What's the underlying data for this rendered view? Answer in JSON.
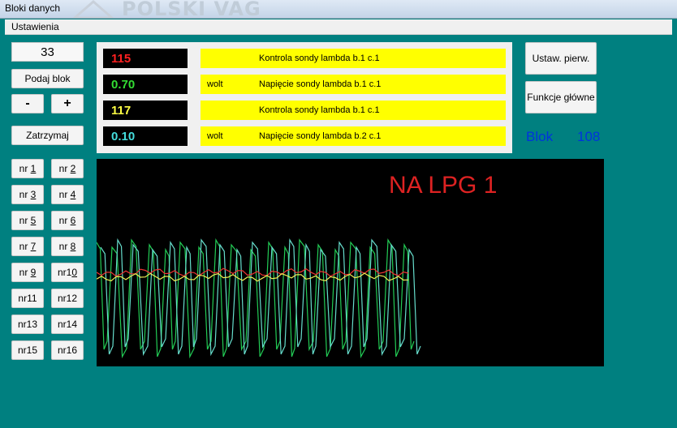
{
  "window": {
    "title": "Bloki danych",
    "watermark": "POLSKI VAG"
  },
  "menu": {
    "items": [
      "Ustawienia"
    ]
  },
  "controls": {
    "counter_value": "33",
    "submit_label": "Podaj blok",
    "minus_label": "-",
    "plus_label": "+",
    "stop_label": "Zatrzymaj"
  },
  "nr_buttons": [
    {
      "prefix": "nr ",
      "digit": "1"
    },
    {
      "prefix": "nr ",
      "digit": "2"
    },
    {
      "prefix": "nr ",
      "digit": "3"
    },
    {
      "prefix": "nr ",
      "digit": "4"
    },
    {
      "prefix": "nr ",
      "digit": "5"
    },
    {
      "prefix": "nr ",
      "digit": "6"
    },
    {
      "prefix": "nr ",
      "digit": "7"
    },
    {
      "prefix": "nr ",
      "digit": "8"
    },
    {
      "prefix": "nr ",
      "digit": "9"
    },
    {
      "prefix": "nr1",
      "digit": "0"
    },
    {
      "prefix": "nr11",
      "digit": ""
    },
    {
      "prefix": "nr12",
      "digit": ""
    },
    {
      "prefix": "nr13",
      "digit": ""
    },
    {
      "prefix": "nr14",
      "digit": ""
    },
    {
      "prefix": "nr15",
      "digit": ""
    },
    {
      "prefix": "nr16",
      "digit": ""
    }
  ],
  "values": [
    {
      "value": "115",
      "color": "#ff2020",
      "unit": "",
      "description": "Kontrola sondy lambda b.1 c.1"
    },
    {
      "value": "0.70",
      "color": "#33dd33",
      "unit": "wolt",
      "description": "Napięcie sondy lambda b.1 c.1"
    },
    {
      "value": "117",
      "color": "#ffff44",
      "unit": "",
      "description": "Kontrola sondy lambda b.1 c.1"
    },
    {
      "value": "0.10",
      "color": "#44dddd",
      "unit": "wolt",
      "description": "Napięcie sondy lambda b.2 c.1"
    }
  ],
  "right_buttons": {
    "settings_label": "Ustaw. pierw.",
    "main_label": "Funkcje główne"
  },
  "blok": {
    "label": "Blok",
    "value": "108"
  },
  "graph": {
    "overlay": "NA LPG 1",
    "colors": {
      "green": "#22cc55",
      "cyan": "#66ddcc",
      "red": "#ee3333",
      "yellow": "#eeee55"
    }
  }
}
